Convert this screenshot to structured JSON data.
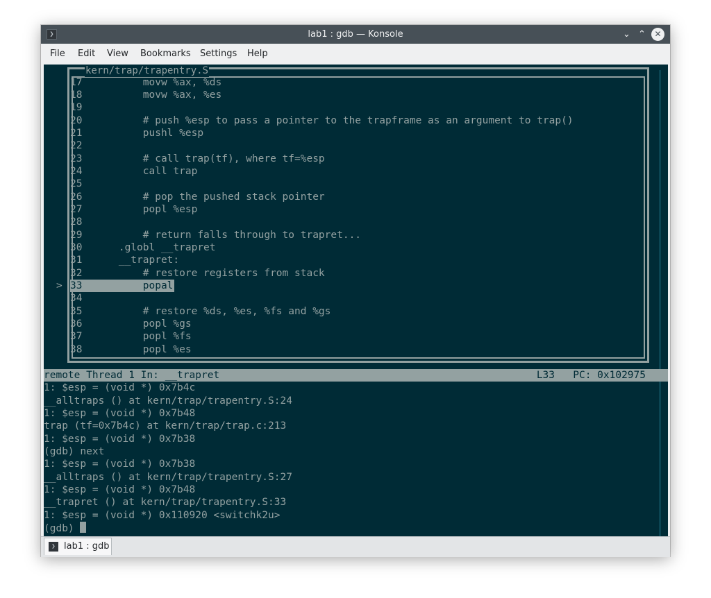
{
  "window": {
    "title": "lab1 : gdb — Konsole",
    "minimize_glyph": "⌄",
    "maximize_glyph": "⌃",
    "close_glyph": "✕",
    "app_icon_glyph": "❯"
  },
  "menu": [
    "File",
    "Edit",
    "View",
    "Bookmarks",
    "Settings",
    "Help"
  ],
  "source": {
    "filename": "kern/trap/trapentry.S",
    "current_marker": ">",
    "lines": [
      "17          movw %ax, %ds",
      "18          movw %ax, %es",
      "19",
      "20          # push %esp to pass a pointer to the trapframe as an argument to trap()",
      "21          pushl %esp",
      "22",
      "23          # call trap(tf), where tf=%esp",
      "24          call trap",
      "25",
      "26          # pop the pushed stack pointer",
      "27          popl %esp",
      "28",
      "29          # return falls through to trapret...",
      "30      .globl __trapret",
      "31      __trapret:",
      "32          # restore registers from stack",
      "33          popal",
      "34",
      "35          # restore %ds, %es, %fs and %gs",
      "36          popl %gs",
      "37          popl %fs",
      "38          popl %es"
    ]
  },
  "status": {
    "left": "remote Thread 1 In: __trapret",
    "line": "L33",
    "pc": "PC: 0x102975"
  },
  "console": [
    "1: $esp = (void *) 0x7b4c",
    "__alltraps () at kern/trap/trapentry.S:24",
    "1: $esp = (void *) 0x7b48",
    "trap (tf=0x7b4c) at kern/trap/trap.c:213",
    "1: $esp = (void *) 0x7b38",
    "(gdb) next",
    "1: $esp = (void *) 0x7b38",
    "__alltraps () at kern/trap/trapentry.S:27",
    "1: $esp = (void *) 0x7b48",
    "__trapret () at kern/trap/trapentry.S:33",
    "1: $esp = (void *) 0x110920 <switchk2u>"
  ],
  "prompt": "(gdb) ",
  "tab": {
    "label": "lab1 : gdb",
    "icon_glyph": "❯"
  }
}
